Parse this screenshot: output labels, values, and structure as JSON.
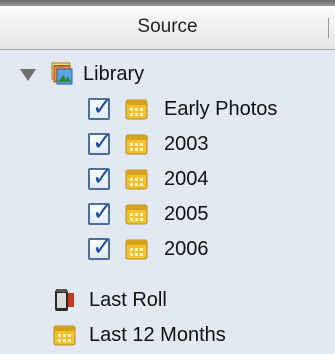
{
  "header": {
    "title": "Source"
  },
  "tree": {
    "library": {
      "label": "Library",
      "icon": "photo-library-icon",
      "expanded": true,
      "children": [
        {
          "label": "Early Photos",
          "checked": true,
          "icon": "calendar-album-icon"
        },
        {
          "label": "2003",
          "checked": true,
          "icon": "calendar-album-icon"
        },
        {
          "label": "2004",
          "checked": true,
          "icon": "calendar-album-icon"
        },
        {
          "label": "2005",
          "checked": true,
          "icon": "calendar-album-icon"
        },
        {
          "label": "2006",
          "checked": true,
          "icon": "calendar-album-icon"
        }
      ]
    },
    "last_roll": {
      "label": "Last Roll",
      "icon": "film-roll-icon"
    },
    "last_12_months": {
      "label": "Last 12 Months",
      "icon": "calendar-album-icon"
    }
  },
  "colors": {
    "pane_background": "#e3e9f3",
    "checkbox_blue": "#1d4f9f",
    "calendar_yellow": "#f2c12e"
  }
}
